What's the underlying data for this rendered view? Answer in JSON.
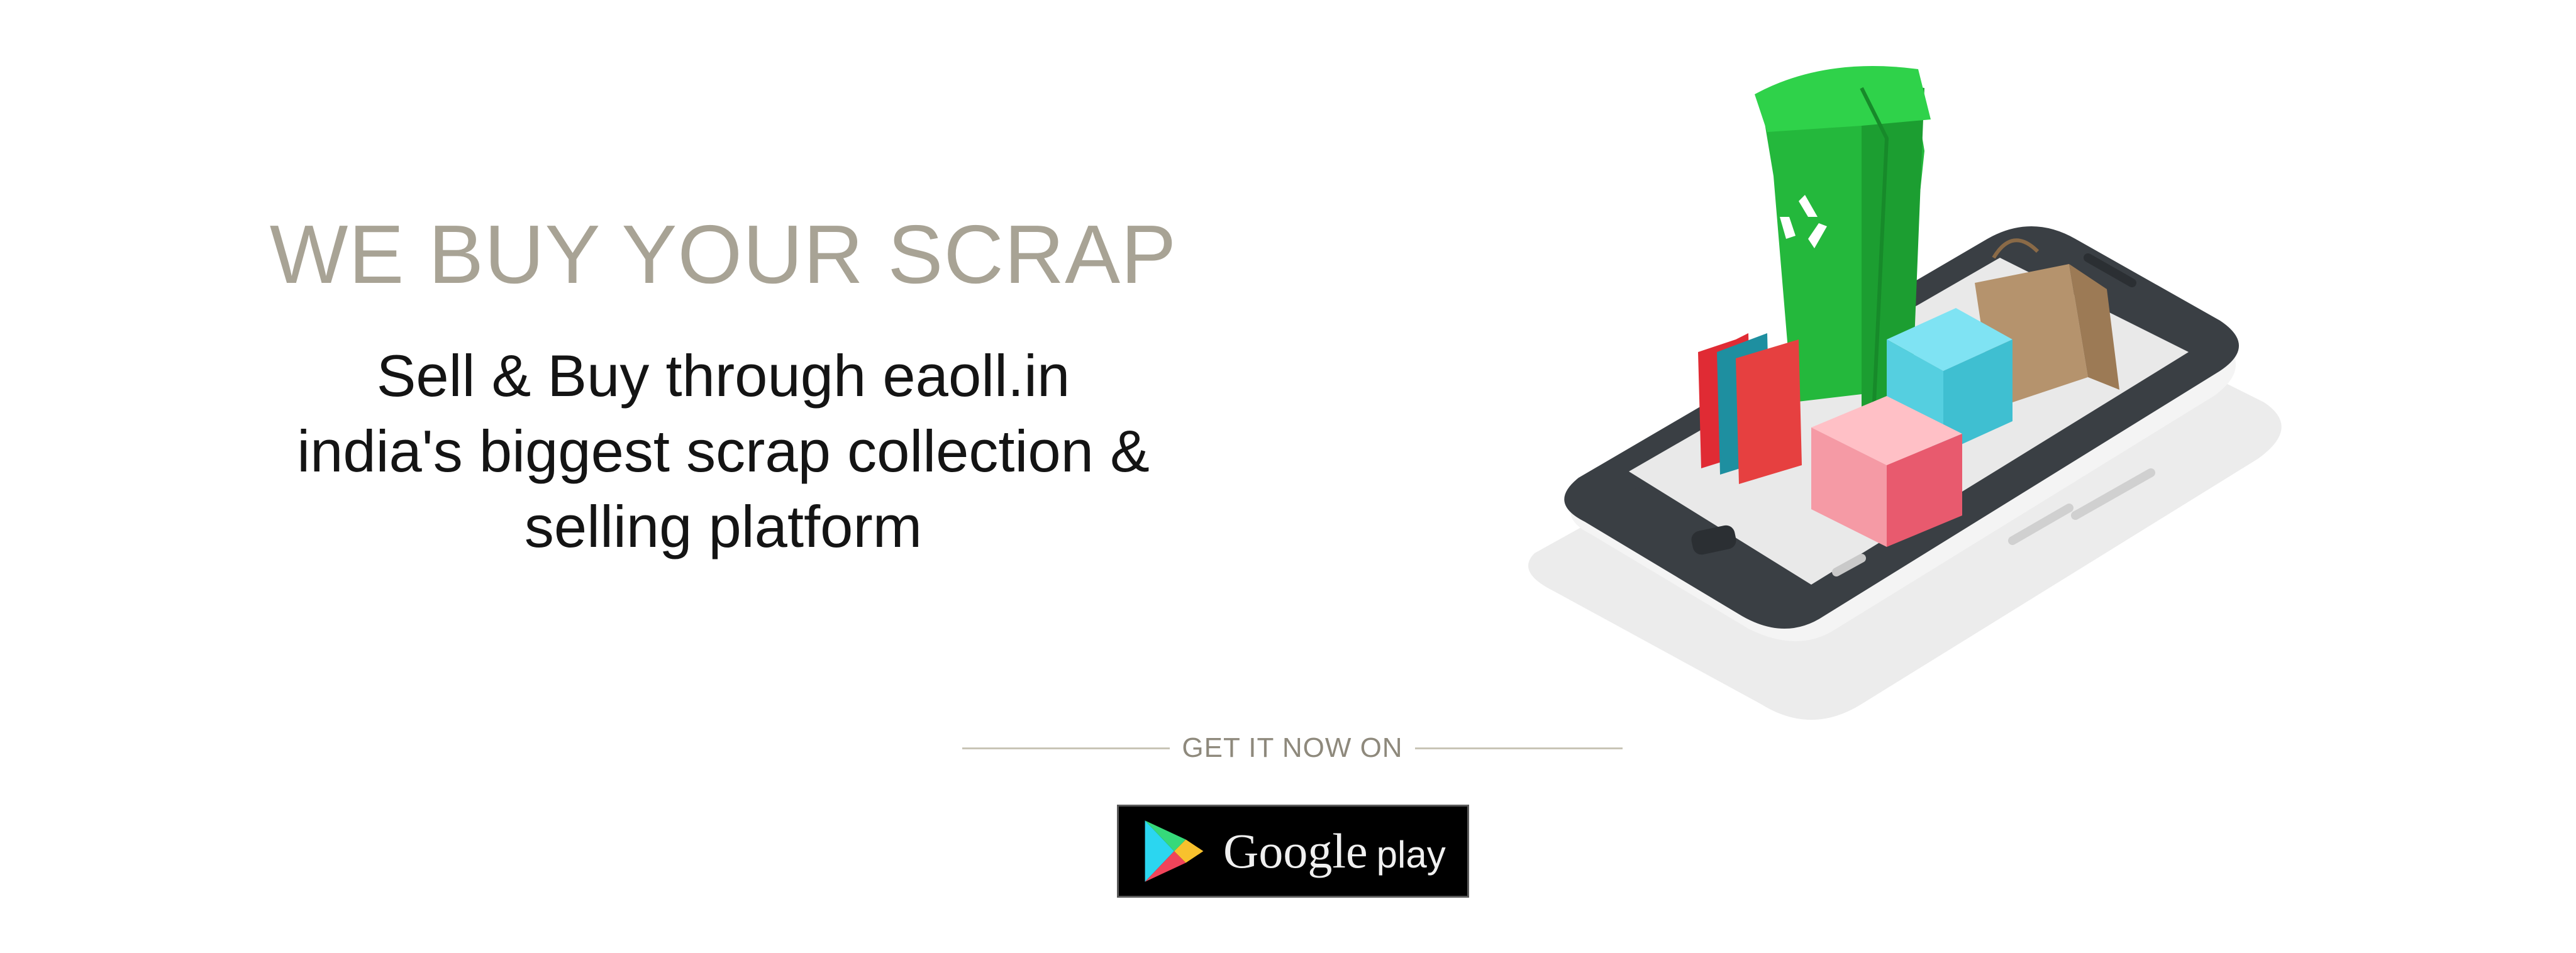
{
  "hero": {
    "headline": "WE BUY YOUR SCRAP",
    "lines": [
      "Sell & Buy through eaoll.in",
      "india's biggest scrap collection &",
      "selling platform"
    ]
  },
  "cta": {
    "label": "GET IT NOW ON",
    "store_brand": "Google",
    "store_suffix": "play",
    "store_icon": "google-play-icon"
  },
  "illustration": {
    "icons": [
      "recycle-bin-icon",
      "smartphone-icon",
      "books-icon",
      "gift-box-icon",
      "paper-bag-icon",
      "recycle-icon"
    ]
  },
  "colors": {
    "headline": "#a8a395",
    "text": "#141414",
    "bin_green": "#22bb3b",
    "badge_bg": "#000000"
  }
}
